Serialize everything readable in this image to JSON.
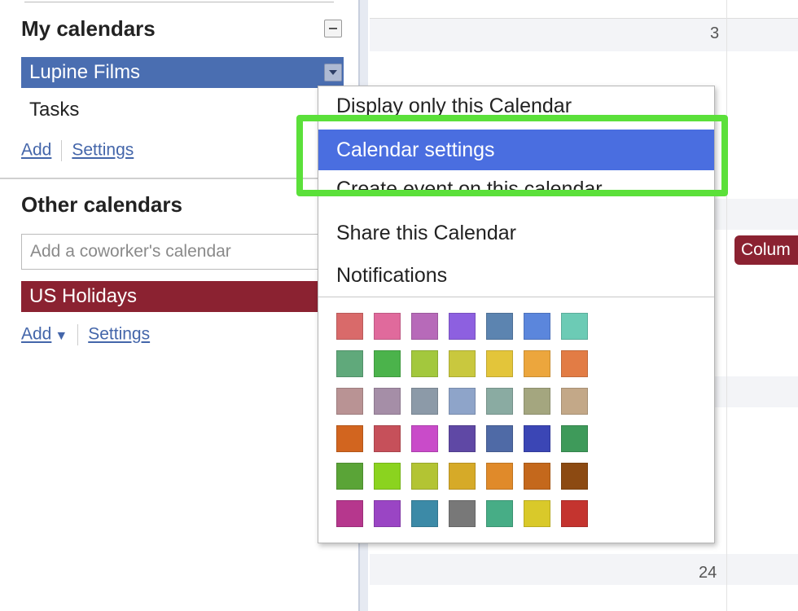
{
  "my_calendars": {
    "title": "My calendars",
    "items": [
      {
        "label": "Lupine Films",
        "color": "#4a6eb1"
      },
      {
        "label": "Tasks"
      }
    ],
    "add_label": "Add",
    "settings_label": "Settings"
  },
  "other_calendars": {
    "title": "Other calendars",
    "input_placeholder": "Add a coworker's calendar",
    "items": [
      {
        "label": "US Holidays",
        "color": "#8b2231"
      }
    ],
    "add_label": "Add",
    "add_caret": "▼",
    "settings_label": "Settings"
  },
  "calendar_grid": {
    "day_numbers": [
      "3",
      "24"
    ],
    "event_chip": "Colum"
  },
  "context_menu": {
    "items": [
      {
        "label": "Display only this Calendar"
      },
      {
        "label": "Calendar settings",
        "highlighted": true
      },
      {
        "label": "Create event on this calendar"
      },
      {
        "label": "Share this Calendar"
      },
      {
        "label": "Notifications"
      }
    ],
    "swatch_colors": [
      [
        "#d96a6a",
        "#e06a9c",
        "#b76ab9",
        "#8d60e0",
        "#5c84b0",
        "#5b86dc",
        "#6ccbb5"
      ],
      [
        "#60a97b",
        "#4bb34b",
        "#a3c83d",
        "#c9c83e",
        "#e3c53a",
        "#eca63d",
        "#e27c45"
      ],
      [
        "#b99394",
        "#a58ea7",
        "#8c9aa8",
        "#8ea4c9",
        "#8aaba2",
        "#a4a67f",
        "#c3a888"
      ],
      [
        "#d2651f",
        "#c6505a",
        "#c94bc9",
        "#5f48a5",
        "#4f6aa6",
        "#3b46b5",
        "#3e9a5a"
      ],
      [
        "#5aa437",
        "#8bd31f",
        "#b3c433",
        "#d6aa28",
        "#e08a2a",
        "#c4681c",
        "#8c4a12"
      ],
      [
        "#b6378d",
        "#9a45c4",
        "#3c8aa7",
        "#787878",
        "#47ad86",
        "#d9c92a",
        "#c4342f"
      ]
    ]
  },
  "highlight_color": "#5be03a"
}
